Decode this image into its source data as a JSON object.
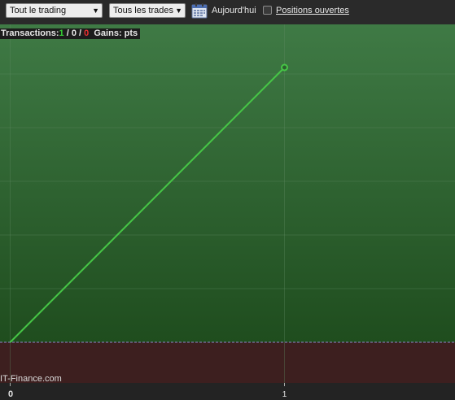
{
  "toolbar": {
    "scope_select": "Tout le trading",
    "trades_select": "Tous les trades",
    "today_label": "Aujourd'hui",
    "open_positions_label": "Positions ouvertes",
    "open_positions_checked": false
  },
  "stats": {
    "transactions_label": "Transactions:",
    "wins": "1",
    "sep1": " / ",
    "neutral": "0",
    "sep2": " / ",
    "losses": "0",
    "gains_label": "Gains: pts"
  },
  "watermark": "IT-Finance.com",
  "colors": {
    "profit_zone_top": "#3f7a45",
    "profit_zone_bottom": "#1f4d1e",
    "loss_zone": "#3d1f1f",
    "line": "#46c646",
    "win": "#35d235",
    "loss": "#e83030"
  },
  "chart_data": {
    "type": "line",
    "x": [
      0,
      1
    ],
    "values": [
      0,
      1
    ],
    "x_ticks": [
      "0",
      "1"
    ]
  }
}
